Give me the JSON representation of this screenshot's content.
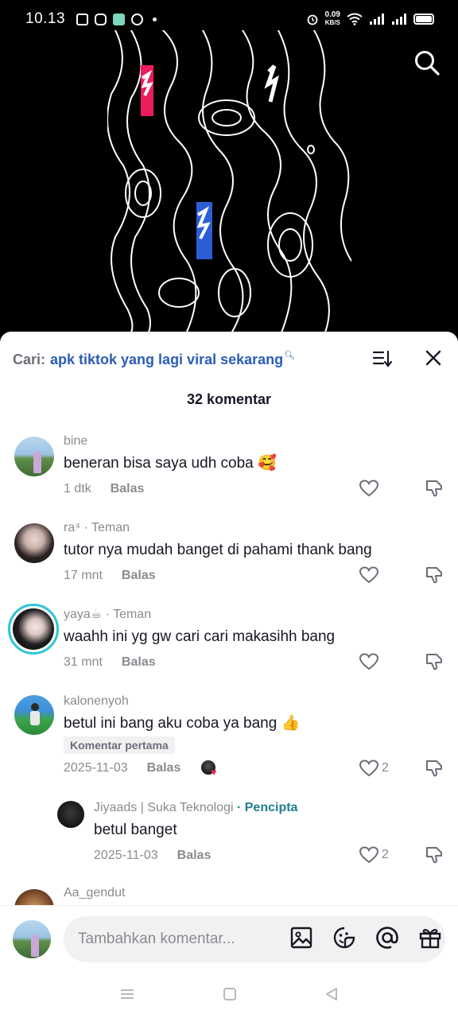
{
  "status_bar": {
    "time": "10.13",
    "net_speed_value": "0.09",
    "net_speed_unit": "KB/S"
  },
  "sheet": {
    "search_prefix": "Cari:",
    "search_query": "apk tiktok yang lagi viral sekarang",
    "comment_count": "32 komentar"
  },
  "comments": [
    {
      "user": "bine",
      "text": "beneran bisa saya udh coba 🥰",
      "time": "1 dtk",
      "reply": "Balas"
    },
    {
      "user": "ra⁴",
      "tag": "· Teman",
      "text": "tutor nya mudah banget di pahami thank bang",
      "time": "17 mnt",
      "reply": "Balas"
    },
    {
      "user": "yaya☕",
      "tag": "· Teman",
      "text": "waahh ini yg gw cari cari makasihh bang",
      "time": "31 mnt",
      "reply": "Balas"
    },
    {
      "user": "kalonenyoh",
      "text": "betul ini bang aku coba ya bang 👍",
      "badge": "Komentar pertama",
      "time": "2025-11-03",
      "reply": "Balas",
      "likes": "2"
    },
    {
      "user": "Jiyaads | Suka Teknologi",
      "tag": "· Pencipta",
      "text": "betul banget",
      "time": "2025-11-03",
      "reply": "Balas",
      "likes": "2"
    },
    {
      "user": "Aa_gendut"
    }
  ],
  "input": {
    "placeholder": "Tambahkan komentar..."
  }
}
